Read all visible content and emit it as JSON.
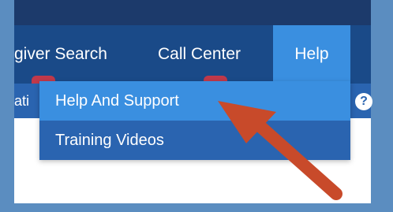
{
  "nav": {
    "items": [
      {
        "label": "giver Search"
      },
      {
        "label": "Call Center"
      },
      {
        "label": "Help"
      }
    ],
    "sub_label": "ati",
    "help_glyph": "?"
  },
  "dropdown": {
    "items": [
      {
        "label": "Help And Support",
        "highlighted": true
      },
      {
        "label": "Training Videos",
        "highlighted": false
      }
    ]
  },
  "colors": {
    "topbar": "#1c3a6b",
    "navbar": "#1a4a88",
    "active": "#3a8fe0",
    "dropdown": "#2a64b0",
    "badge": "#c0394a",
    "annotation_arrow": "#c84a2a"
  },
  "annotation": {
    "icon": "arrow-pointer-annotation"
  }
}
